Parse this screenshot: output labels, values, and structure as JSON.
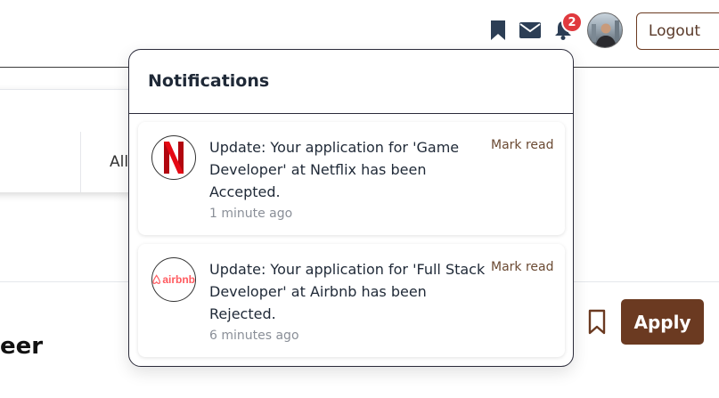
{
  "header": {
    "badge_count": "2",
    "logout_label": "Logout",
    "icons": [
      "bookmark-icon",
      "mail-icon",
      "bell-icon"
    ]
  },
  "background": {
    "filter_label": "All",
    "job_title_fragment": "eer",
    "apply_label": "Apply"
  },
  "notifications": {
    "title": "Notifications",
    "items": [
      {
        "company": "Netflix",
        "message": "Update: Your application for 'Game Developer' at Netflix has been Accepted.",
        "time": "1 minute ago",
        "action": "Mark read"
      },
      {
        "company": "airbnb",
        "message": "Update: Your application for 'Full Stack Developer' at Airbnb has been Rejected.",
        "time": "6 minutes ago",
        "action": "Mark read"
      }
    ]
  },
  "colors": {
    "brand_brown": "#6b3a21",
    "badge_red": "#e0393e",
    "netflix_red": "#e50914",
    "airbnb_pink": "#ff5a5f"
  }
}
